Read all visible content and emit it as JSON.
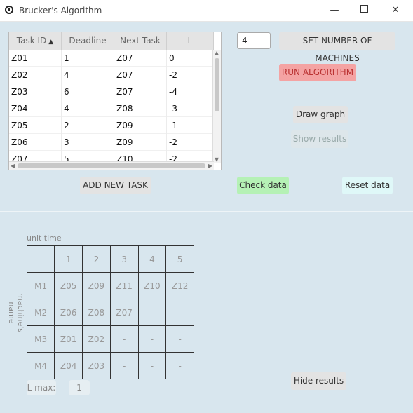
{
  "window": {
    "title": "Brucker's Algorithm"
  },
  "table": {
    "headers": [
      "Task ID",
      "Deadline",
      "Next Task",
      "L"
    ],
    "rows": [
      [
        "Z01",
        "1",
        "Z07",
        "0"
      ],
      [
        "Z02",
        "4",
        "Z07",
        "-2"
      ],
      [
        "Z03",
        "6",
        "Z07",
        "-4"
      ],
      [
        "Z04",
        "4",
        "Z08",
        "-3"
      ],
      [
        "Z05",
        "2",
        "Z09",
        "-1"
      ],
      [
        "Z06",
        "3",
        "Z09",
        "-2"
      ],
      [
        "Z07",
        "5",
        "Z10",
        "-2"
      ]
    ]
  },
  "controls": {
    "machines_value": "4",
    "set_machines": "SET NUMBER OF MACHINES",
    "run": "RUN ALGORITHM",
    "draw_graph": "Draw graph",
    "show_results": "Show results",
    "add_task": "ADD NEW TASK",
    "check_data": "Check data",
    "reset_data": "Reset data",
    "hide_results": "Hide results"
  },
  "colors": {
    "run": "#f4a3a3",
    "check": "#b5f1b5",
    "reset": "#dff8f8"
  },
  "results": {
    "unit_time_label": "unit time",
    "machine_label": "machine's name",
    "time_headers": [
      "1",
      "2",
      "3",
      "4",
      "5"
    ],
    "machines": [
      {
        "name": "M1",
        "cells": [
          "Z05",
          "Z09",
          "Z11",
          "Z10",
          "Z12"
        ]
      },
      {
        "name": "M2",
        "cells": [
          "Z06",
          "Z08",
          "Z07",
          "-",
          "-"
        ]
      },
      {
        "name": "M3",
        "cells": [
          "Z01",
          "Z02",
          "-",
          "-",
          "-"
        ]
      },
      {
        "name": "M4",
        "cells": [
          "Z04",
          "Z03",
          "-",
          "-",
          "-"
        ]
      }
    ],
    "lmax_label": "L max:",
    "lmax_value": "1"
  }
}
